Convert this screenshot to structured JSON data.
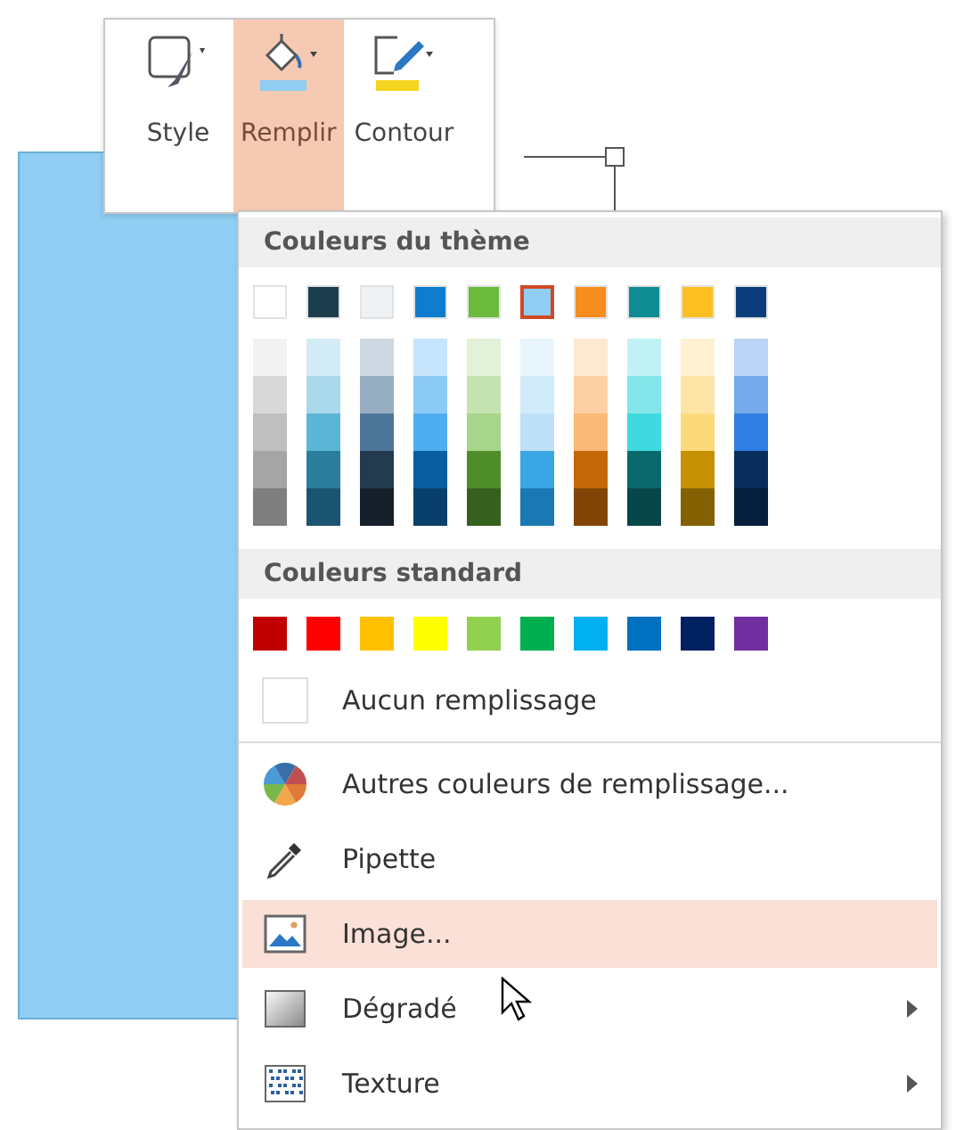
{
  "toolbar": {
    "buttons": [
      {
        "label": "Style",
        "kind": "style",
        "selected": false
      },
      {
        "label": "Remplir",
        "kind": "fill",
        "selected": true
      },
      {
        "label": "Contour",
        "kind": "outline",
        "selected": false
      }
    ]
  },
  "menu": {
    "theme_header": "Couleurs du thème",
    "theme_colors": [
      {
        "color": "#ffffff",
        "selected": false,
        "shades": [
          {
            "color": "#f2f2f2"
          },
          {
            "color": "#d8d8d8"
          },
          {
            "color": "#bfbfbf"
          },
          {
            "color": "#a5a5a5"
          },
          {
            "color": "#7f7f7f"
          }
        ]
      },
      {
        "color": "#1c3d4c",
        "selected": false,
        "shades": [
          {
            "color": "#d4ecf6"
          },
          {
            "color": "#a8d8ea"
          },
          {
            "color": "#5bb6d6"
          },
          {
            "color": "#2a7d9c"
          },
          {
            "color": "#1a5470"
          }
        ]
      },
      {
        "color": "#eef2f5",
        "selected": false,
        "shades": [
          {
            "color": "#cdd8e2"
          },
          {
            "color": "#97aec2"
          },
          {
            "color": "#4d7699"
          },
          {
            "color": "#243a4f"
          },
          {
            "color": "#141f2a"
          }
        ]
      },
      {
        "color": "#0f7ccf",
        "selected": false,
        "shades": [
          {
            "color": "#c6e4fb"
          },
          {
            "color": "#8ccaf6"
          },
          {
            "color": "#4eaef0"
          },
          {
            "color": "#0a5d9e"
          },
          {
            "color": "#083f6b"
          }
        ]
      },
      {
        "color": "#6cbb3c",
        "selected": false,
        "shades": [
          {
            "color": "#e2f1d8"
          },
          {
            "color": "#c5e3b1"
          },
          {
            "color": "#a7d58b"
          },
          {
            "color": "#4f8d2b"
          },
          {
            "color": "#35601d"
          }
        ]
      },
      {
        "color": "#8fcdf2",
        "selected": true,
        "shades": [
          {
            "color": "#e8f5fc"
          },
          {
            "color": "#d2ebfa"
          },
          {
            "color": "#bce1f8"
          },
          {
            "color": "#3ba6e6"
          },
          {
            "color": "#1a79b3"
          }
        ]
      },
      {
        "color": "#f78c1f",
        "selected": false,
        "shades": [
          {
            "color": "#fde8d1"
          },
          {
            "color": "#fcd0a4"
          },
          {
            "color": "#fab977"
          },
          {
            "color": "#c46709"
          },
          {
            "color": "#834506"
          }
        ]
      },
      {
        "color": "#0e8c92",
        "selected": false,
        "shades": [
          {
            "color": "#c0f2f5"
          },
          {
            "color": "#82e6ea"
          },
          {
            "color": "#3fd9e0"
          },
          {
            "color": "#0a696d"
          },
          {
            "color": "#074649"
          }
        ]
      },
      {
        "color": "#fcbf22",
        "selected": false,
        "shades": [
          {
            "color": "#fef2d2"
          },
          {
            "color": "#fee5a6"
          },
          {
            "color": "#fdd979"
          },
          {
            "color": "#c69103"
          },
          {
            "color": "#846102"
          }
        ]
      },
      {
        "color": "#0b3d7a",
        "selected": false,
        "shades": [
          {
            "color": "#b9d4f5"
          },
          {
            "color": "#74a9eb"
          },
          {
            "color": "#2f7ee1"
          },
          {
            "color": "#082d5b"
          },
          {
            "color": "#051e3d"
          }
        ]
      }
    ],
    "standard_header": "Couleurs standard",
    "standard_colors": [
      {
        "color": "#c00000"
      },
      {
        "color": "#ff0000"
      },
      {
        "color": "#ffc000"
      },
      {
        "color": "#ffff00"
      },
      {
        "color": "#92d050"
      },
      {
        "color": "#00b050"
      },
      {
        "color": "#00b0f0"
      },
      {
        "color": "#0070c0"
      },
      {
        "color": "#002060"
      },
      {
        "color": "#7030a0"
      }
    ],
    "items": [
      {
        "kind": "none",
        "label": "Aucun remplissage",
        "highlighted": false,
        "submenu": false
      },
      {
        "kind": "more",
        "label": "Autres couleurs de remplissage...",
        "highlighted": false,
        "submenu": false
      },
      {
        "kind": "eyedropper",
        "label": "Pipette",
        "highlighted": false,
        "submenu": false
      },
      {
        "kind": "picture",
        "label": "Image...",
        "highlighted": true,
        "submenu": false
      },
      {
        "kind": "gradient",
        "label": "Dégradé",
        "highlighted": false,
        "submenu": true
      },
      {
        "kind": "texture",
        "label": "Texture",
        "highlighted": false,
        "submenu": true
      }
    ]
  }
}
